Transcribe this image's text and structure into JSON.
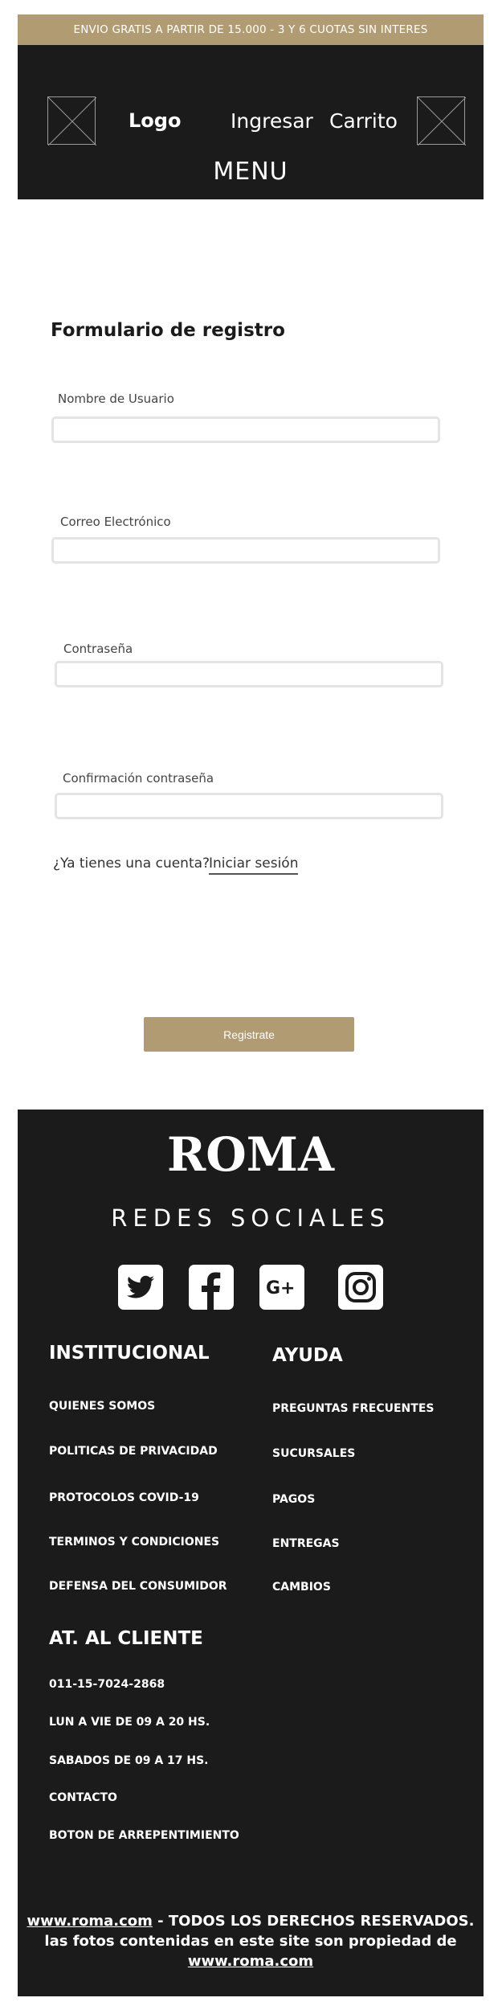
{
  "promo_banner": {
    "text": "ENVIO GRATIS A PARTIR DE 15.000 - 3 Y 6 CUOTAS SIN INTERES"
  },
  "header": {
    "logo": "Logo",
    "login": "Ingresar",
    "cart": "Carrito",
    "menu": "MENU"
  },
  "form": {
    "title": "Formulario de registro",
    "fields": [
      {
        "label": "Nombre de Usuario",
        "value": "",
        "placeholder": ""
      },
      {
        "label": "Correo Electrónico",
        "value": "",
        "placeholder": ""
      },
      {
        "label": "Contraseña",
        "value": "",
        "placeholder": ""
      },
      {
        "label": "Confirmación contraseña",
        "value": "",
        "placeholder": ""
      }
    ],
    "account_question": "¿Ya tienes una cuenta?",
    "login_link": "Iniciar sesión",
    "submit": "Registrate"
  },
  "footer": {
    "brand": "ROMA",
    "social_title": "REDES SOCIALES",
    "social_icons": [
      "twitter-icon",
      "facebook-icon",
      "google-plus-icon",
      "instagram-icon"
    ],
    "institucional": {
      "title": "INSTITUCIONAL",
      "links": [
        "QUIENES SOMOS",
        "POLITICAS DE PRIVACIDAD",
        "PROTOCOLOS COVID-19",
        "TERMINOS Y CONDICIONES",
        "DEFENSA DEL CONSUMIDOR"
      ]
    },
    "ayuda": {
      "title": "AYUDA",
      "links": [
        "PREGUNTAS FRECUENTES",
        "SUCURSALES",
        "PAGOS",
        "ENTREGAS",
        "CAMBIOS"
      ]
    },
    "cliente": {
      "title": "AT. AL CLIENTE",
      "phone": "011-15-7024-2868",
      "hours_week": "LUN A VIE DE 09 A 20 HS.",
      "hours_sat": "SABADOS DE 09 A 17 HS.",
      "links": [
        "CONTACTO",
        "BOTON DE ARREPENTIMIENTO"
      ]
    },
    "copyright": {
      "site": "www.roma.com",
      "line1_rest": " - TODOS LOS DERECHOS RESERVADOS.",
      "line2": "las fotos contenidas en este site son propiedad de",
      "site2": "www.roma.com"
    }
  },
  "colors": {
    "accent": "#b09b72",
    "dark": "#1c1b1b",
    "input_border": "#e4e4e4"
  }
}
